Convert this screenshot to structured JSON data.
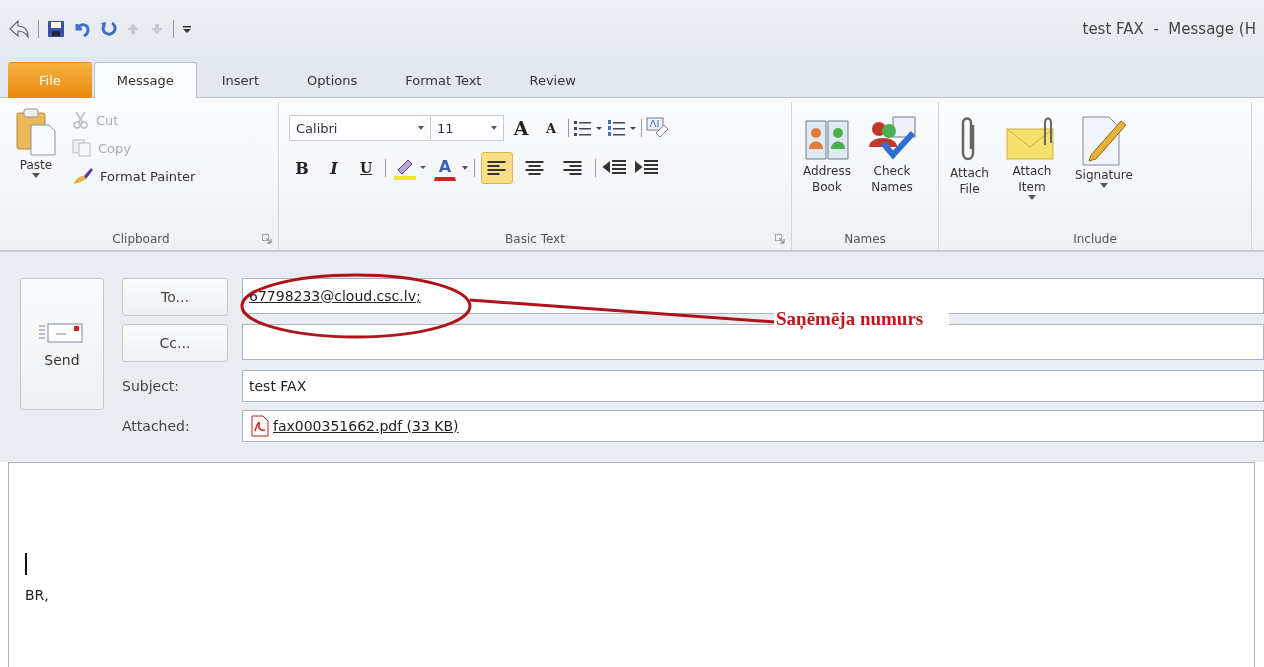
{
  "window": {
    "title": "test FAX  -  Message (H"
  },
  "tabs": [
    {
      "label": "File",
      "kind": "file",
      "selected": false
    },
    {
      "label": "Message",
      "kind": "tab",
      "selected": true
    },
    {
      "label": "Insert",
      "kind": "tab",
      "selected": false
    },
    {
      "label": "Options",
      "kind": "tab",
      "selected": false
    },
    {
      "label": "Format Text",
      "kind": "tab",
      "selected": false
    },
    {
      "label": "Review",
      "kind": "tab",
      "selected": false
    }
  ],
  "ribbon": {
    "clipboard": {
      "label": "Clipboard",
      "paste": "Paste",
      "cut": {
        "label": "Cut",
        "disabled": true
      },
      "copy": {
        "label": "Copy",
        "disabled": true
      },
      "format_painter": {
        "label": "Format Painter",
        "disabled": false
      }
    },
    "basic_text": {
      "label": "Basic Text",
      "font": "Calibri",
      "size": "11",
      "grow": "A",
      "shrink": "A",
      "bold": "B",
      "italic": "I",
      "underline": "U",
      "font_color": "A",
      "alignment": [
        {
          "selected": true
        },
        {
          "selected": false
        },
        {
          "selected": false
        }
      ]
    },
    "names": {
      "label": "Names",
      "buttons": [
        {
          "label": "Address Book",
          "kind": "book"
        },
        {
          "label": "Check Names",
          "kind": "check"
        }
      ]
    },
    "include": {
      "label": "Include",
      "buttons": [
        {
          "label": "Attach File",
          "kind": "clip",
          "dropdown": false
        },
        {
          "label": "Attach Item",
          "kind": "envelope",
          "dropdown": true
        },
        {
          "label": "Signature",
          "kind": "signature",
          "dropdown": true
        }
      ]
    }
  },
  "compose": {
    "send": "Send",
    "fields": [
      {
        "label": "To...",
        "kind": "button",
        "value": "67798233@cloud.csc.lv;"
      },
      {
        "label": "Cc...",
        "kind": "button"
      },
      {
        "label": "Subject:",
        "kind": "text",
        "value": "test FAX"
      },
      {
        "label": "Attached:",
        "kind": "attachment",
        "value": "fax000351662.pdf (33 KB)"
      }
    ],
    "body": "BR,"
  },
  "annotation": {
    "text": "Saņēmēja numurs"
  }
}
